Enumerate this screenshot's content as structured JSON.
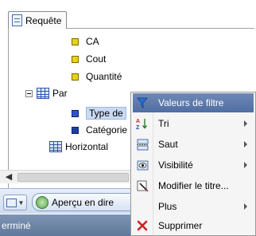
{
  "query_panel": {
    "tab_label": "Requête"
  },
  "tree": {
    "items": [
      {
        "label": "CA",
        "kind": "measure"
      },
      {
        "label": "Cout",
        "kind": "measure"
      },
      {
        "label": "Quantité",
        "kind": "measure"
      }
    ],
    "group": {
      "label": "Par",
      "children": [
        {
          "label": "Type de",
          "selected": true
        },
        {
          "label": "Catégorie",
          "selected": false
        }
      ]
    },
    "horizontal": {
      "label": "Horizontal"
    }
  },
  "toolbar": {
    "preview_label": "Aperçu en dire"
  },
  "statusbar": {
    "text": "erminé"
  },
  "context_menu": {
    "items": [
      {
        "label": "Valeurs de filtre",
        "icon": "funnel-icon",
        "highlighted": true,
        "submenu": false
      },
      {
        "label": "Tri",
        "icon": "sort-icon",
        "highlighted": false,
        "submenu": true
      },
      {
        "label": "Saut",
        "icon": "break-icon",
        "highlighted": false,
        "submenu": true
      },
      {
        "label": "Visibilité",
        "icon": "visibility-icon",
        "highlighted": false,
        "submenu": true
      },
      {
        "label": "Modifier le titre...",
        "icon": "edit-title-icon",
        "highlighted": false,
        "submenu": false
      },
      {
        "label": "Plus",
        "icon": "",
        "highlighted": false,
        "submenu": true
      },
      {
        "label": "Supprimer",
        "icon": "delete-icon",
        "highlighted": false,
        "submenu": false
      }
    ]
  },
  "colors": {
    "menu_highlight": "#5a78ab",
    "measure_bullet": "#e8d21a",
    "dimension_bullet": "#1f3f9e",
    "statusbar": "#6f87a8"
  }
}
